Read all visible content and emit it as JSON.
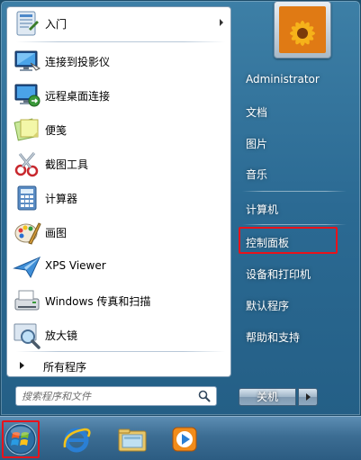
{
  "left_pane": {
    "programs": [
      {
        "label": "入门",
        "icon": "getting-started-icon",
        "has_submenu": true
      },
      {
        "label": "连接到投影仪",
        "icon": "projector-icon",
        "has_submenu": false
      },
      {
        "label": "远程桌面连接",
        "icon": "remote-desktop-icon",
        "has_submenu": false
      },
      {
        "label": "便笺",
        "icon": "sticky-notes-icon",
        "has_submenu": false
      },
      {
        "label": "截图工具",
        "icon": "snipping-tool-icon",
        "has_submenu": false
      },
      {
        "label": "计算器",
        "icon": "calculator-icon",
        "has_submenu": false
      },
      {
        "label": "画图",
        "icon": "paint-icon",
        "has_submenu": false
      },
      {
        "label": "XPS Viewer",
        "icon": "xps-viewer-icon",
        "has_submenu": false
      },
      {
        "label": "Windows 传真和扫描",
        "icon": "fax-scan-icon",
        "has_submenu": false
      },
      {
        "label": "放大镜",
        "icon": "magnifier-icon",
        "has_submenu": false
      }
    ],
    "all_programs_label": "所有程序"
  },
  "search": {
    "placeholder": "搜索程序和文件"
  },
  "right_pane": {
    "items": [
      {
        "label": "Administrator"
      },
      {
        "label": "文档"
      },
      {
        "label": "图片"
      },
      {
        "label": "音乐"
      },
      {
        "label": "计算机"
      },
      {
        "label": "控制面板"
      },
      {
        "label": "设备和打印机"
      },
      {
        "label": "默认程序"
      },
      {
        "label": "帮助和支持"
      }
    ]
  },
  "shutdown": {
    "label": "关机"
  },
  "taskbar": {
    "icons": [
      "start-orb-icon",
      "internet-explorer-icon",
      "file-explorer-icon",
      "media-player-icon"
    ]
  },
  "colors": {
    "highlight": "#e8131b",
    "menu_bg": "#2b6a93",
    "taskbar_bg": "#3c6d93"
  }
}
